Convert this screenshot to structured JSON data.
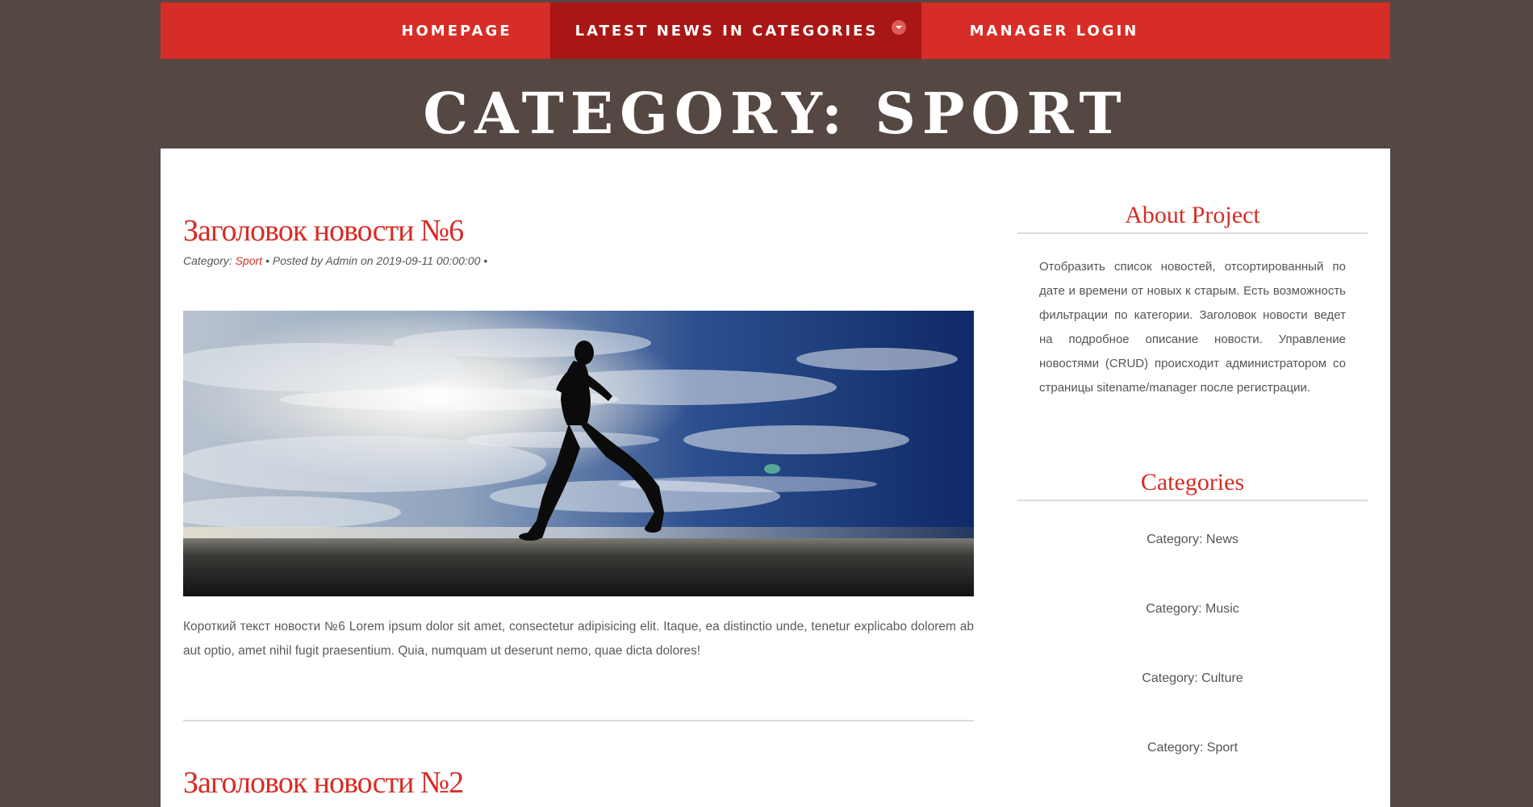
{
  "nav": {
    "items": [
      {
        "label": "HOMEPAGE"
      },
      {
        "label": "LATEST NEWS IN CATEGORIES"
      },
      {
        "label": "MANAGER LOGIN"
      }
    ]
  },
  "page": {
    "title": "CATEGORY: SPORT"
  },
  "posts": [
    {
      "title": "Заголовок новости №6",
      "meta_prefix": "Category: ",
      "category": "Sport",
      "meta_suffix": " • Posted by Admin on 2019-09-11 00:00:00  •",
      "image": "runner-silhouette-sky-photo",
      "excerpt": "Короткий текст новости №6 Lorem ipsum dolor sit amet, consectetur adipisicing elit. Itaque, ea distinctio unde, tenetur explicabo dolorem ab aut optio, amet nihil fugit praesentium. Quia, numquam ut deserunt nemo, quae dicta dolores!"
    },
    {
      "title": "Заголовок новости №2"
    }
  ],
  "sidebar": {
    "about": {
      "title": "About Project",
      "text": "Отобразить список новостей, отсортированный по дате и времени от новых к старым. Есть возможность фильтрации по категории. Заголовок новости ведет на подробное описание новости. Управление новостями (CRUD) происходит администратором со страницы sitename/manager после регистрации."
    },
    "categories": {
      "title": "Categories",
      "items": [
        {
          "label": "Category: News"
        },
        {
          "label": "Category: Music"
        },
        {
          "label": "Category: Culture"
        },
        {
          "label": "Category: Sport"
        }
      ]
    }
  },
  "colors": {
    "background": "#554742",
    "brand_red": "#d62d26",
    "nav_active": "#a81715",
    "panel": "#ffffff",
    "text_gray": "#555555"
  },
  "icons": {
    "nav_dropdown": "chevron-down-icon"
  }
}
